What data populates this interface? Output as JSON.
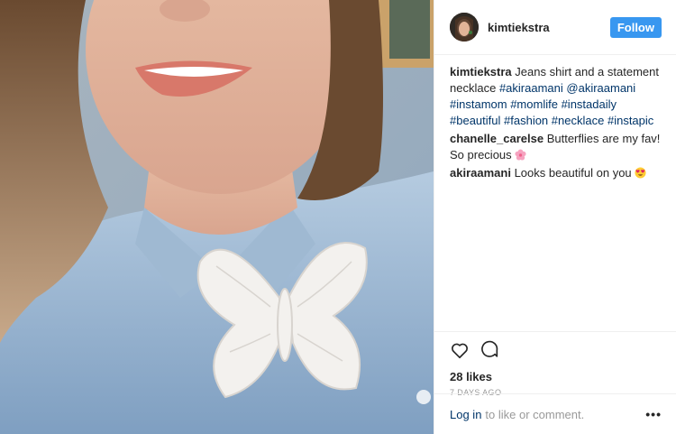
{
  "photo": {
    "alt_icon": "selfie-photo"
  },
  "header": {
    "avatar_icon": "avatar-icon",
    "username": "kimtiekstra",
    "follow_label": "Follow"
  },
  "caption": {
    "user": "kimtiekstra",
    "text_start": "Jeans shirt and a statement necklace",
    "tokens": [
      "#akiraamani",
      "@akiraamani",
      "#instamom",
      "#momlife",
      "#instadaily",
      "#beautiful",
      "#fashion",
      "#necklace",
      "#instapic"
    ]
  },
  "comments": [
    {
      "user": "chanelle_carelse",
      "text": "Butterflies are my fav! So precious",
      "emoji": "cherry-blossom-emoji"
    },
    {
      "user": "akiraamani",
      "text": "Looks beautiful on you",
      "emoji": "heart-eyes-emoji"
    }
  ],
  "actions": {
    "like_icon": "heart-icon",
    "comment_icon": "comment-icon",
    "likes": "28 likes",
    "time": "7 DAYS AGO"
  },
  "footer": {
    "login_label": "Log in",
    "rest": "to like or comment.",
    "more_label": "•••"
  },
  "colors": {
    "accent": "#3897f0",
    "link": "#003569"
  }
}
